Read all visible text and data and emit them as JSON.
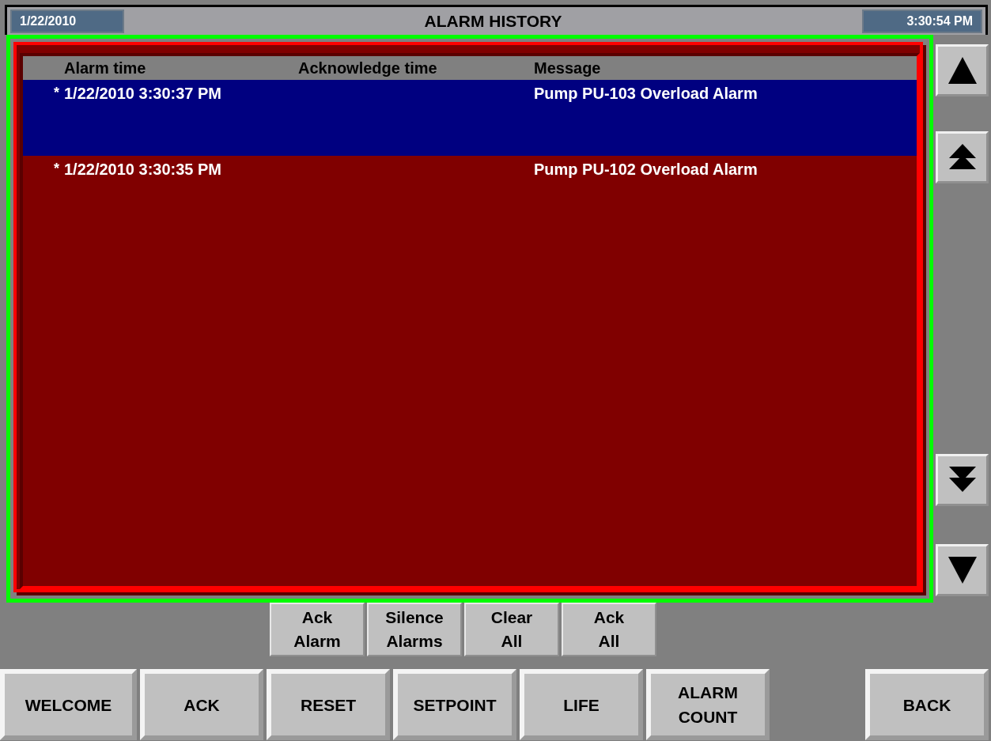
{
  "header": {
    "date": "1/22/2010",
    "title": "ALARM HISTORY",
    "time": "3:30:54 PM"
  },
  "table": {
    "columns": [
      "Alarm time",
      "Acknowledge time",
      "Message"
    ],
    "rows": [
      {
        "marker": "*",
        "alarm_time": "1/22/2010 3:30:37 PM",
        "message": "Pump PU-103 Overload Alarm",
        "selected": true
      },
      {
        "marker": "*",
        "alarm_time": "1/22/2010 3:30:35 PM",
        "message": "Pump PU-102 Overload Alarm",
        "selected": false
      }
    ]
  },
  "scroll_buttons": [
    {
      "kind": "up"
    },
    {
      "kind": "page-up"
    },
    {
      "kind": "page-down"
    },
    {
      "kind": "down"
    }
  ],
  "alarm_buttons": [
    [
      "Ack",
      "Alarm"
    ],
    [
      "Silence",
      "Alarms"
    ],
    [
      "Clear",
      "All"
    ],
    [
      "Ack",
      "All"
    ]
  ],
  "nav_buttons": [
    [
      "WELCOME"
    ],
    [
      "ACK"
    ],
    [
      "RESET"
    ],
    [
      "SETPOINT"
    ],
    [
      "LIFE"
    ],
    [
      "ALARM",
      "COUNT"
    ],
    [
      "BACK"
    ]
  ]
}
